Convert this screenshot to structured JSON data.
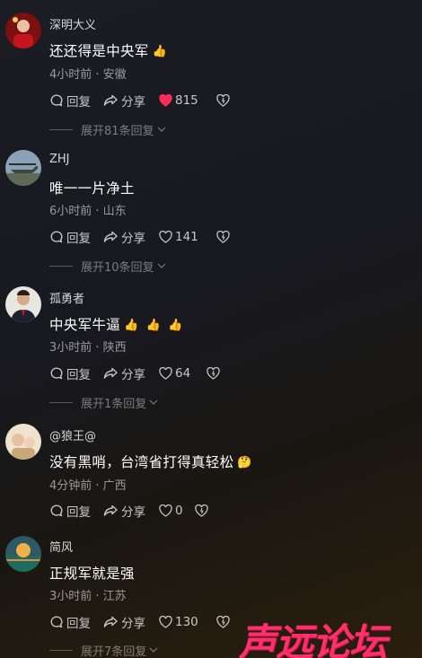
{
  "comments": [
    {
      "user": "深明大义",
      "text": "还还得是中央军",
      "emojis": [
        "👍"
      ],
      "meta": "4小时前 · 安徽",
      "reply_label": "回复",
      "share_label": "分享",
      "likes": "815",
      "liked": true,
      "expand": "展开81条回复"
    },
    {
      "user": "ZHJ",
      "text": "唯一一片净土",
      "emojis": [],
      "meta": "6小时前 · 山东",
      "reply_label": "回复",
      "share_label": "分享",
      "likes": "141",
      "liked": false,
      "expand": "展开10条回复"
    },
    {
      "user": "孤勇者",
      "text": "中央军牛逼",
      "emojis": [
        "👍",
        "👍",
        "👍"
      ],
      "meta": "3小时前 · 陕西",
      "reply_label": "回复",
      "share_label": "分享",
      "likes": "64",
      "liked": false,
      "expand": "展开1条回复"
    },
    {
      "user": "@狼王@",
      "text": "没有黑哨，台湾省打得真轻松",
      "emojis": [
        "🤔"
      ],
      "meta": "4分钟前 · 广西",
      "reply_label": "回复",
      "share_label": "分享",
      "likes": "0",
      "liked": false,
      "expand": ""
    },
    {
      "user": "简风",
      "text": "正规军就是强",
      "emojis": [],
      "meta": "3小时前 · 江苏",
      "reply_label": "回复",
      "share_label": "分享",
      "likes": "130",
      "liked": false,
      "expand": "展开7条回复"
    }
  ],
  "watermark": "声远论坛",
  "colors": {
    "like_active": "#ff2c55",
    "watermark": "#ff2f6d"
  },
  "icons": [
    "reply-bubble-icon",
    "share-arrow-icon",
    "heart-icon",
    "dislike-heart-icon",
    "chevron-down-icon"
  ]
}
